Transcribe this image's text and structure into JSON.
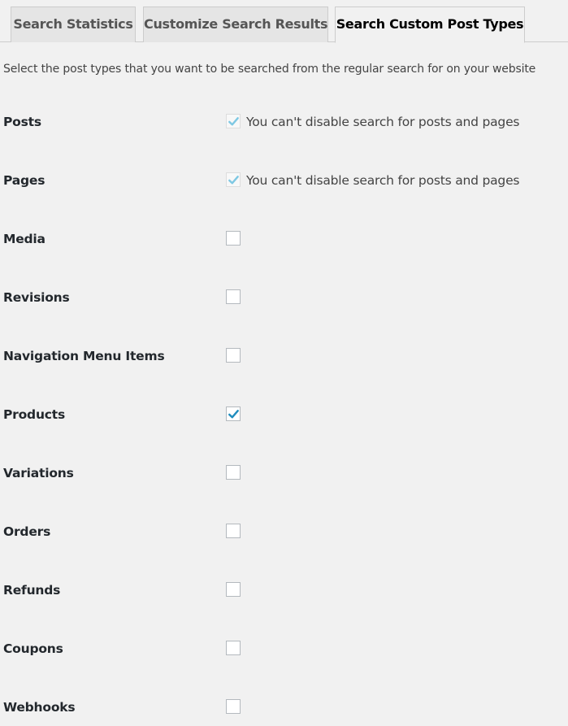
{
  "tabs": [
    {
      "label": "Search Statistics",
      "active": false
    },
    {
      "label": "Customize Search Results",
      "active": false
    },
    {
      "label": "Search Custom Post Types",
      "active": true
    }
  ],
  "intro": "Select the post types that you want to be searched from the regular search for on your website",
  "colors": {
    "check_enabled": "#1e8cbe",
    "check_disabled": "#7ec8e3",
    "background": "#f1f1f1"
  },
  "post_types": [
    {
      "label": "Posts",
      "checked": true,
      "disabled": true,
      "note": "You can't disable search for posts and pages"
    },
    {
      "label": "Pages",
      "checked": true,
      "disabled": true,
      "note": "You can't disable search for posts and pages"
    },
    {
      "label": "Media",
      "checked": false,
      "disabled": false
    },
    {
      "label": "Revisions",
      "checked": false,
      "disabled": false
    },
    {
      "label": "Navigation Menu Items",
      "checked": false,
      "disabled": false
    },
    {
      "label": "Products",
      "checked": true,
      "disabled": false
    },
    {
      "label": "Variations",
      "checked": false,
      "disabled": false
    },
    {
      "label": "Orders",
      "checked": false,
      "disabled": false
    },
    {
      "label": "Refunds",
      "checked": false,
      "disabled": false
    },
    {
      "label": "Coupons",
      "checked": false,
      "disabled": false
    },
    {
      "label": "Webhooks",
      "checked": false,
      "disabled": false
    }
  ]
}
